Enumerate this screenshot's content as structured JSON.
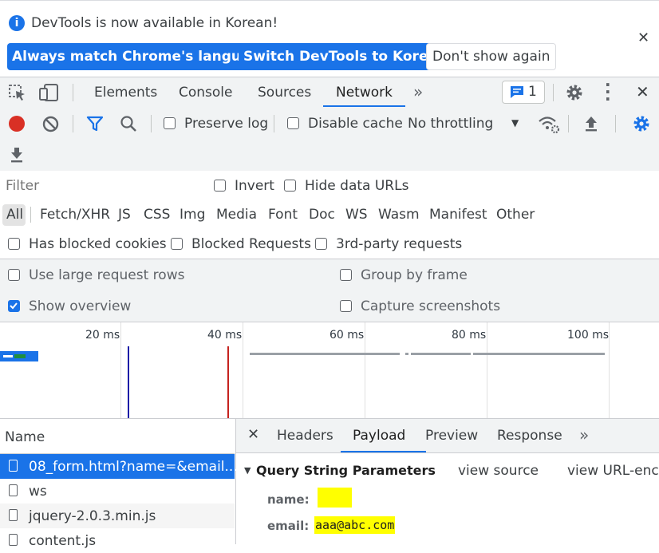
{
  "infobar": {
    "message": "DevTools is now available in Korean!",
    "btn_match": "Always match Chrome's language",
    "btn_switch": "Switch DevTools to Korean",
    "btn_dont_show": "Don't show again"
  },
  "tabs": {
    "items": [
      "Elements",
      "Console",
      "Sources",
      "Network"
    ],
    "active": "Network",
    "issues_count": "1"
  },
  "toolbar": {
    "preserve_log": "Preserve log",
    "disable_cache": "Disable cache",
    "throttling": "No throttling"
  },
  "filter": {
    "placeholder": "Filter",
    "invert": "Invert",
    "hide_data_urls": "Hide data URLs",
    "types": [
      "All",
      "Fetch/XHR",
      "JS",
      "CSS",
      "Img",
      "Media",
      "Font",
      "Doc",
      "WS",
      "Wasm",
      "Manifest",
      "Other"
    ],
    "has_blocked_cookies": "Has blocked cookies",
    "blocked_requests": "Blocked Requests",
    "third_party": "3rd-party requests"
  },
  "settings": {
    "large_rows": "Use large request rows",
    "group_by_frame": "Group by frame",
    "show_overview": "Show overview",
    "capture_screenshots": "Capture screenshots"
  },
  "overview": {
    "ticks": [
      "20 ms",
      "40 ms",
      "60 ms",
      "80 ms",
      "100 ms"
    ]
  },
  "requests": {
    "header": "Name",
    "rows": [
      "08_form.html?name=&email...",
      "ws",
      "jquery-2.0.3.min.js",
      "content.js"
    ]
  },
  "detail": {
    "tabs": [
      "Headers",
      "Payload",
      "Preview",
      "Response"
    ],
    "active_tab": "Payload",
    "section_title": "Query String Parameters",
    "view_source": "view source",
    "view_url_encoded": "view URL-enco",
    "params": [
      {
        "key": "name:",
        "value": ""
      },
      {
        "key": "email:",
        "value": "aaa@abc.com"
      }
    ]
  },
  "colors": {
    "accent": "#1a73e8",
    "record": "#d93025",
    "highlight": "#ffff00"
  }
}
